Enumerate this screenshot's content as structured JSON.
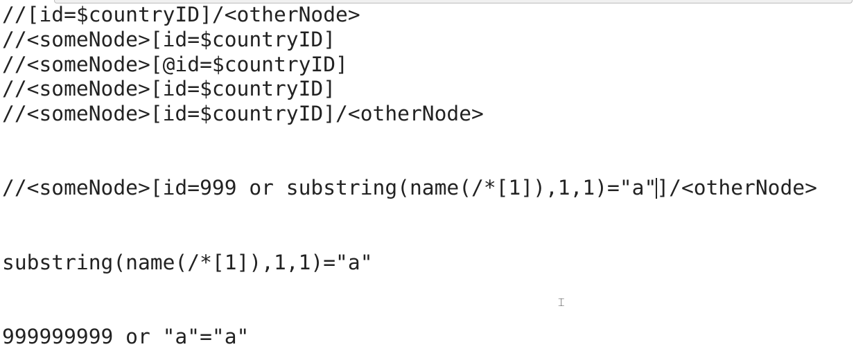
{
  "editor": {
    "lines": [
      "//[id=$countryID]/<otherNode>",
      "//<someNode>[id=$countryID]",
      "//<someNode>[@id=$countryID]",
      "//<someNode>[id=$countryID]",
      "//<someNode>[id=$countryID]/<otherNode>",
      "",
      "",
      "//<someNode>[id=999 or substring(name(/*[1]),1,1)=\"a\"]/<otherNode>",
      "",
      "",
      "substring(name(/*[1]),1,1)=\"a\"",
      "",
      "",
      "999999999 or \"a\"=\"a\""
    ],
    "caret_line_before": "//<someNode>[id=999 or substring(name(/*[1]),1,1)=\"a\"",
    "caret_line_after": "]/<otherNode>"
  }
}
